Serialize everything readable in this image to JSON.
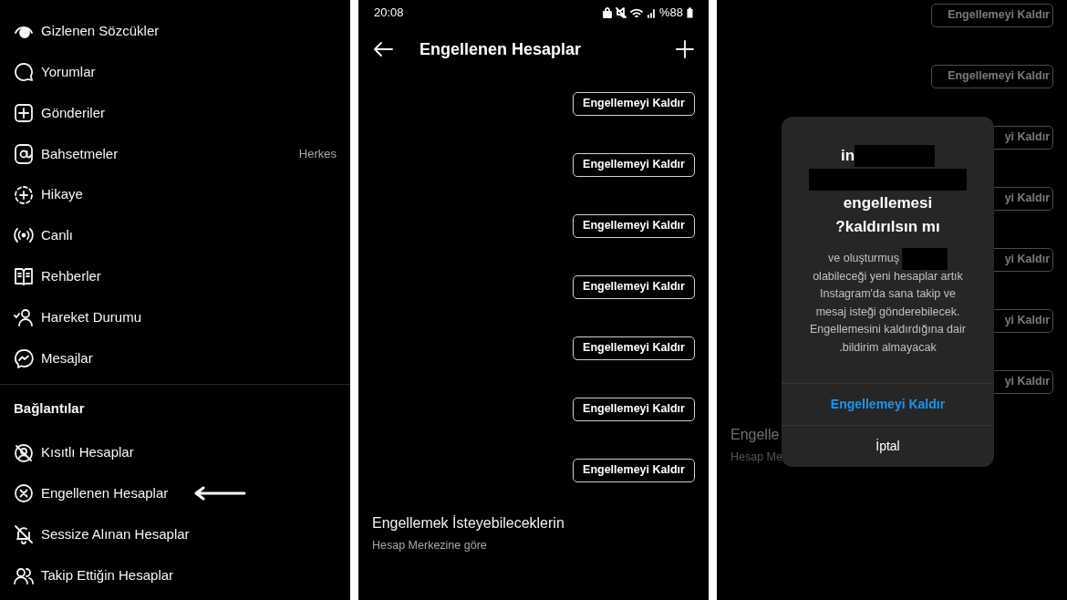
{
  "settings_menu": {
    "items": [
      {
        "label": "Gizlenen Sözcükler"
      },
      {
        "label": "Yorumlar"
      },
      {
        "label": "Gönderiler"
      },
      {
        "label": "Bahsetmeler",
        "value": "Herkes"
      },
      {
        "label": "Hikaye"
      },
      {
        "label": "Canlı"
      },
      {
        "label": "Rehberler"
      },
      {
        "label": "Hareket Durumu"
      },
      {
        "label": "Mesajlar"
      }
    ],
    "section_title": "Bağlantılar",
    "section_items": [
      {
        "label": "Kısıtlı Hesaplar",
        "pointed": false
      },
      {
        "label": "Engellenen Hesaplar",
        "pointed": true
      },
      {
        "label": "Sessize Alınan Hesaplar",
        "pointed": false
      },
      {
        "label": "Takip Ettiğin Hesaplar",
        "pointed": false
      }
    ]
  },
  "blocked_screen": {
    "status_bar": {
      "time": "20:08",
      "battery": "%88"
    },
    "title": "Engellenen Hesaplar",
    "rows": [
      {
        "button": "Engellemeyi Kaldır"
      },
      {
        "button": "Engellemeyi Kaldır"
      },
      {
        "button": "Engellemeyi Kaldır"
      },
      {
        "button": "Engellemeyi Kaldır"
      },
      {
        "button": "Engellemeyi Kaldır"
      },
      {
        "button": "Engellemeyi Kaldır"
      },
      {
        "button": "Engellemeyi Kaldır"
      }
    ],
    "suggestions": {
      "title": "Engellemek İsteyebileceklerin",
      "subtitle": "Hesap Merkezine göre"
    }
  },
  "dialog_screen": {
    "background_rows": [
      {
        "button": "Engellemeyi Kaldır"
      },
      {
        "button": "Engellemeyi Kaldır"
      },
      {
        "button": "yi Kaldır"
      },
      {
        "button": "yi Kaldır"
      },
      {
        "button": "yi Kaldır"
      },
      {
        "button": "yi Kaldır"
      },
      {
        "button": "yi Kaldır"
      }
    ],
    "background_title": "Engelle",
    "background_subtitle": "Hesap Me",
    "dialog": {
      "title_lines": [
        {
          "text": "in",
          "redacted": true
        },
        {
          "redacted": true
        },
        {
          "text": "engellemesi",
          "redacted": false
        },
        {
          "text": "?kaldırılsın mı",
          "redacted": false
        }
      ],
      "body_lines": [
        {
          "text": "ve oluşturmuş",
          "redacted": true
        },
        {
          "text": "olabileceği yeni hesaplar artık",
          "redacted": false
        },
        {
          "text": "Instagram'da sana takip ve",
          "redacted": false
        },
        {
          "text": "mesaj isteği gönderebilecek.",
          "redacted": false
        },
        {
          "text": "Engellemesini kaldırdığına dair",
          "redacted": false
        },
        {
          "text": ".bildirim almayacak",
          "redacted": false
        }
      ],
      "confirm": "Engellemeyi Kaldır",
      "cancel": "İptal"
    }
  }
}
